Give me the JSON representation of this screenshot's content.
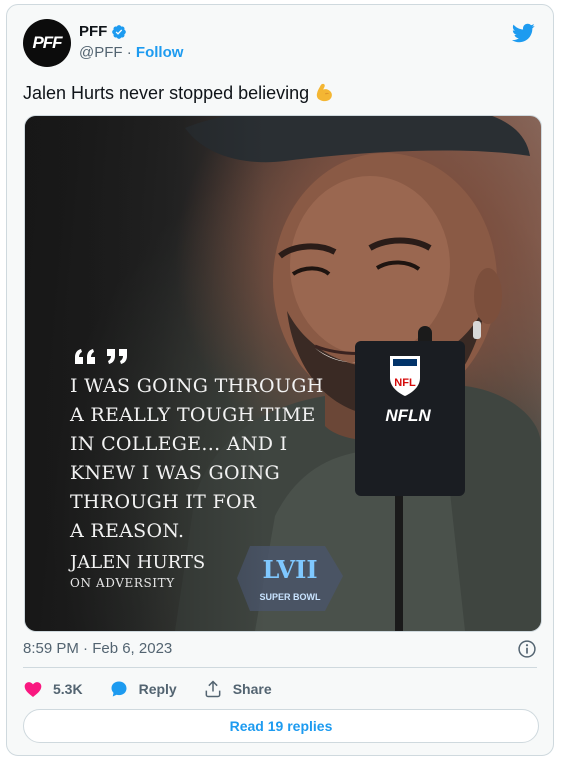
{
  "account": {
    "name": "PFF",
    "handle": "@PFF",
    "separator": "·",
    "follow_label": "Follow",
    "avatar_text": "PFF"
  },
  "tweet": {
    "text": "Jalen Hurts never stopped believing",
    "emoji_icon": "flexed-biceps-icon",
    "timestamp": "8:59 PM · Feb 6, 2023"
  },
  "media": {
    "quote_marks": "❝❞",
    "quote_text": "I WAS GOING THROUGH\nA REALLY TOUGH TIME\nIN COLLEGE... AND I\nKNEW I WAS GOING\nTHROUGH IT FOR\nA REASON.",
    "author": "JALEN HURTS",
    "subtitle": "ON ADVERSITY",
    "mic_flag_logo": "NFL",
    "mic_flag_text": "NFLN",
    "badge_text": "SUPER BOWL"
  },
  "actions": {
    "like_count": "5.3K",
    "reply_label": "Reply",
    "share_label": "Share"
  },
  "read_replies_label": "Read 19 replies",
  "colors": {
    "accent": "#1d9bf0",
    "like": "#f91880",
    "text_secondary": "#536471"
  }
}
